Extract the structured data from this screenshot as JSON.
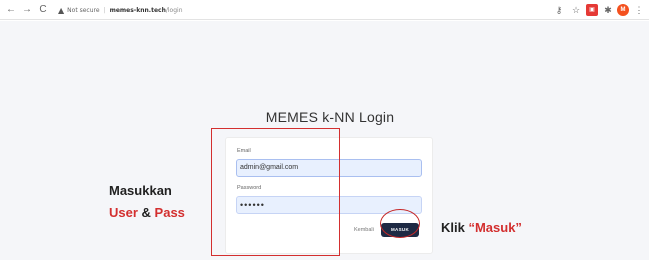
{
  "browser": {
    "back_icon": "←",
    "forward_icon": "→",
    "reload_icon": "C",
    "security_label": "Not secure",
    "host": "memes-knn.tech",
    "path": "/login",
    "star_icon": "☆",
    "avatar_letter": "M",
    "menu_icon": "⋮"
  },
  "page": {
    "title": "MEMES k-NN Login"
  },
  "form": {
    "email_label": "Email",
    "email_value": "admin@gmail.com",
    "password_label": "Password",
    "password_value": "••••••",
    "back_button": "Kembali",
    "submit_button": "MASUK"
  },
  "annotations": {
    "line1": "Masukkan",
    "user": "User",
    "amp": " & ",
    "pass": "Pass",
    "klik": "Klik ",
    "masuk_quote": "“Masuk”",
    "accent_color": "#d32f2f"
  }
}
